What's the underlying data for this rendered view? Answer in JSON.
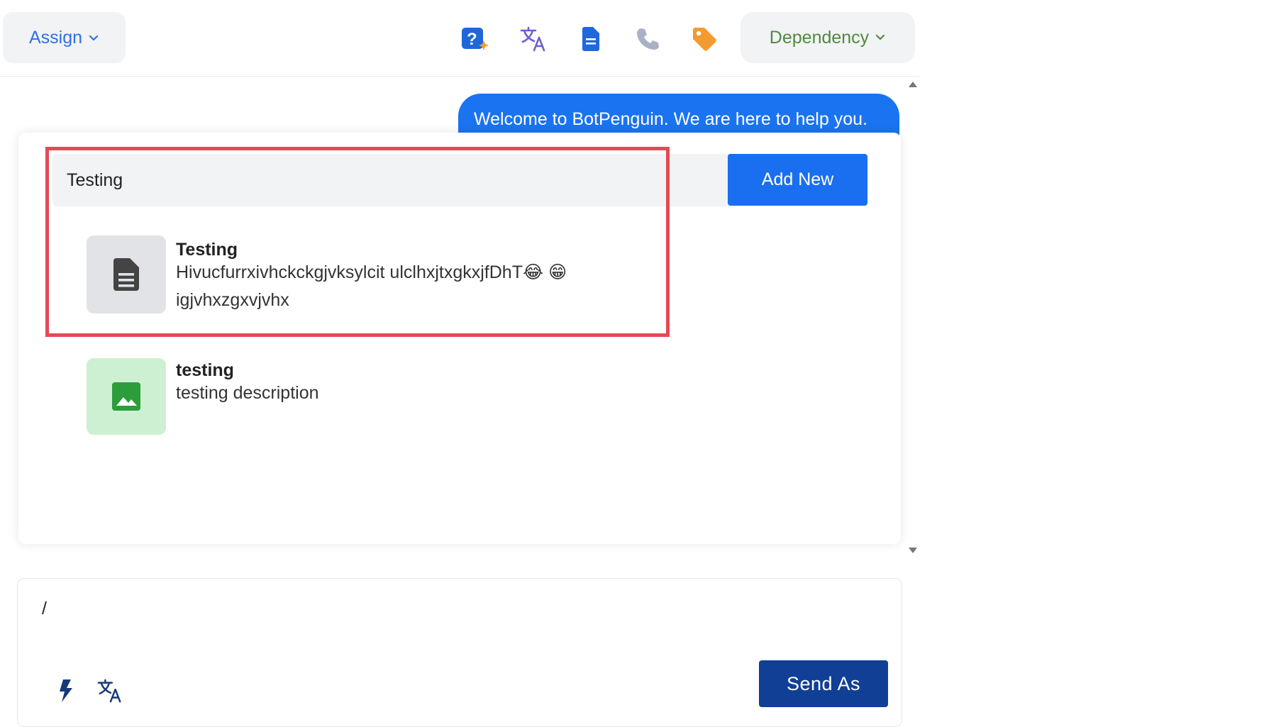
{
  "header": {
    "assign_label": "Assign",
    "dependency_label": "Dependency",
    "icons": [
      "ai-help-icon",
      "translate-icon",
      "document-icon",
      "phone-icon",
      "tag-icon"
    ]
  },
  "chat": {
    "bot_message": "Welcome to BotPenguin. We are here to help you."
  },
  "popup": {
    "search_value": "Testing",
    "add_new_label": "Add New",
    "items": [
      {
        "title": "Testing",
        "description_line1": "Hivucfurrxivhckckgjvksylcit ulclhxjtxgkxjfDhT😂 😁",
        "description_line2": "igjvhxzgxvjvhx",
        "icon": "document-icon"
      },
      {
        "title": "testing",
        "description_line1": "testing description",
        "icon": "image-icon"
      }
    ]
  },
  "composer": {
    "text": "/",
    "send_label": "Send As"
  },
  "colors": {
    "primary_blue": "#1a6ff0",
    "send_button": "#103f95",
    "highlight_border": "#e34a55",
    "dependency_text": "#4f8a3c",
    "tag_icon": "#f39b2e"
  }
}
